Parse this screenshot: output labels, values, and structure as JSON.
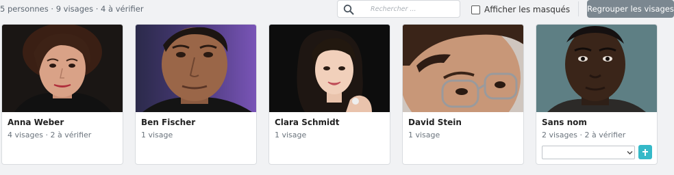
{
  "toolbar": {
    "summary": "5 personnes · 9 visages · 4 à vérifier",
    "search_placeholder": "Rechercher ...",
    "search_value": "",
    "show_hidden_label": "Afficher les masqués",
    "show_hidden_checked": false,
    "group_button_label": "Regrouper les visages"
  },
  "people": [
    {
      "name": "Anna Weber",
      "meta": "4 visages · 2 à vérifier"
    },
    {
      "name": "Ben Fischer",
      "meta": "1 visage"
    },
    {
      "name": "Clara Schmidt",
      "meta": "1 visage"
    },
    {
      "name": "David Stein",
      "meta": "1 visage"
    },
    {
      "name": "Sans nom",
      "meta": "2 visages · 2 à vérifier",
      "assign_value": "",
      "add_icon": "plus-icon"
    }
  ],
  "colors": {
    "accent": "#35b9c8",
    "group_button": "#7b8790",
    "page_background": "#f1f2f4"
  }
}
